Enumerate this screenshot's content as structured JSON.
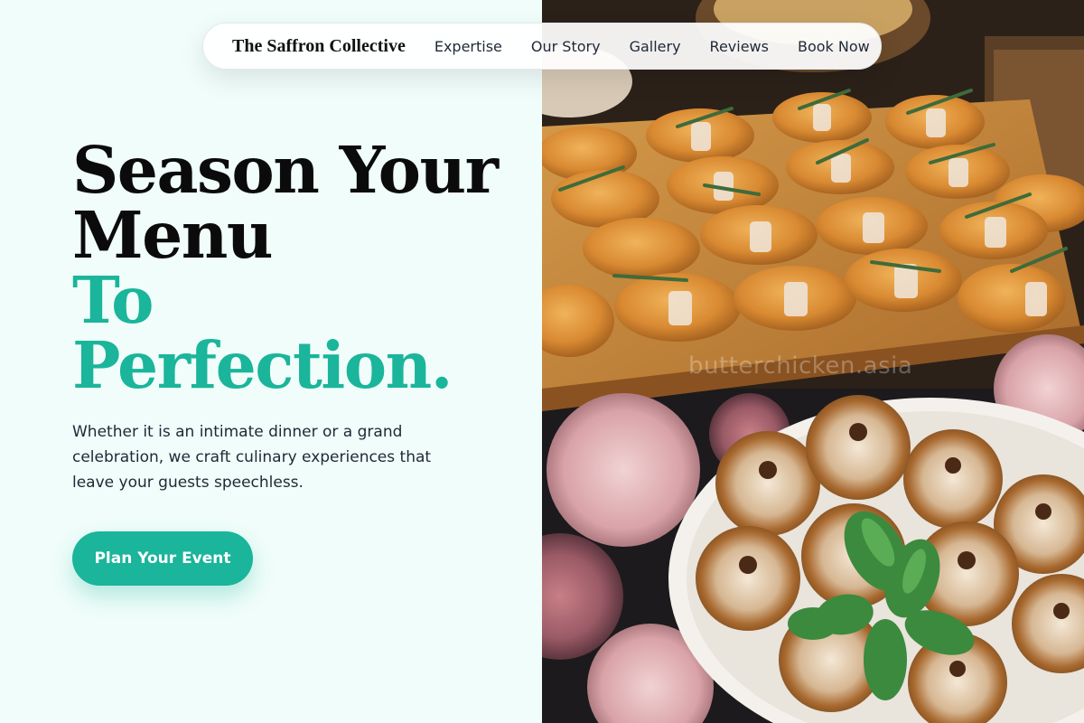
{
  "nav": {
    "brand": "The Saffron Collective",
    "links": [
      "Expertise",
      "Our Story",
      "Gallery",
      "Reviews",
      "Book Now"
    ]
  },
  "hero": {
    "headline_line1": "Season Your",
    "headline_line2": "Menu",
    "headline_accent_line1": "To",
    "headline_accent_line2": "Perfection.",
    "description": "Whether it is an intimate dinner or a grand celebration, we craft culinary experiences that leave your guests speechless.",
    "cta_label": "Plan Your Event"
  },
  "image": {
    "subject": "catering spread of croissants tied with twine and rosemary, and chocolate mousse tartlets with mint",
    "watermark": "butterchicken.asia"
  },
  "colors": {
    "accent": "#1ab59a",
    "background": "#f0fdfa",
    "text": "#0b0b0b"
  }
}
